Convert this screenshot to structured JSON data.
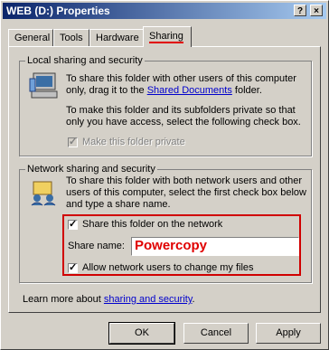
{
  "window": {
    "title": "WEB (D:) Properties",
    "help_label": "?",
    "close_label": "×"
  },
  "tabs": [
    {
      "label": "General"
    },
    {
      "label": "Tools"
    },
    {
      "label": "Hardware"
    },
    {
      "label": "Sharing",
      "active": true
    }
  ],
  "local": {
    "title": "Local sharing and security",
    "text1a": "To share this folder with other users of this computer",
    "text1b": "only, drag it to the ",
    "link": "Shared Documents",
    "text1c": " folder.",
    "text2a": "To make this folder and its subfolders private so that",
    "text2b": "only you have access, select the following check box.",
    "private_label": "Make this folder private",
    "private_checked": false
  },
  "network": {
    "title": "Network sharing and security",
    "text1": "To share this folder with both network users and other",
    "text2": "users of this computer, select the first check box below",
    "text3": "and type a share name.",
    "share_label": "Share this folder on the network",
    "share_checked": true,
    "share_name_label": "Share name:",
    "share_name_value": "Powercopy",
    "change_label": "Allow network users to change my files",
    "change_checked": true
  },
  "learn": {
    "prefix": "Learn more about ",
    "link": "sharing and security",
    "suffix": "."
  },
  "buttons": {
    "ok": "OK",
    "cancel": "Cancel",
    "apply": "Apply"
  },
  "colors": {
    "title_bar": "#0a246a",
    "highlight": "#d00000",
    "share_name_text": "#e00000"
  }
}
